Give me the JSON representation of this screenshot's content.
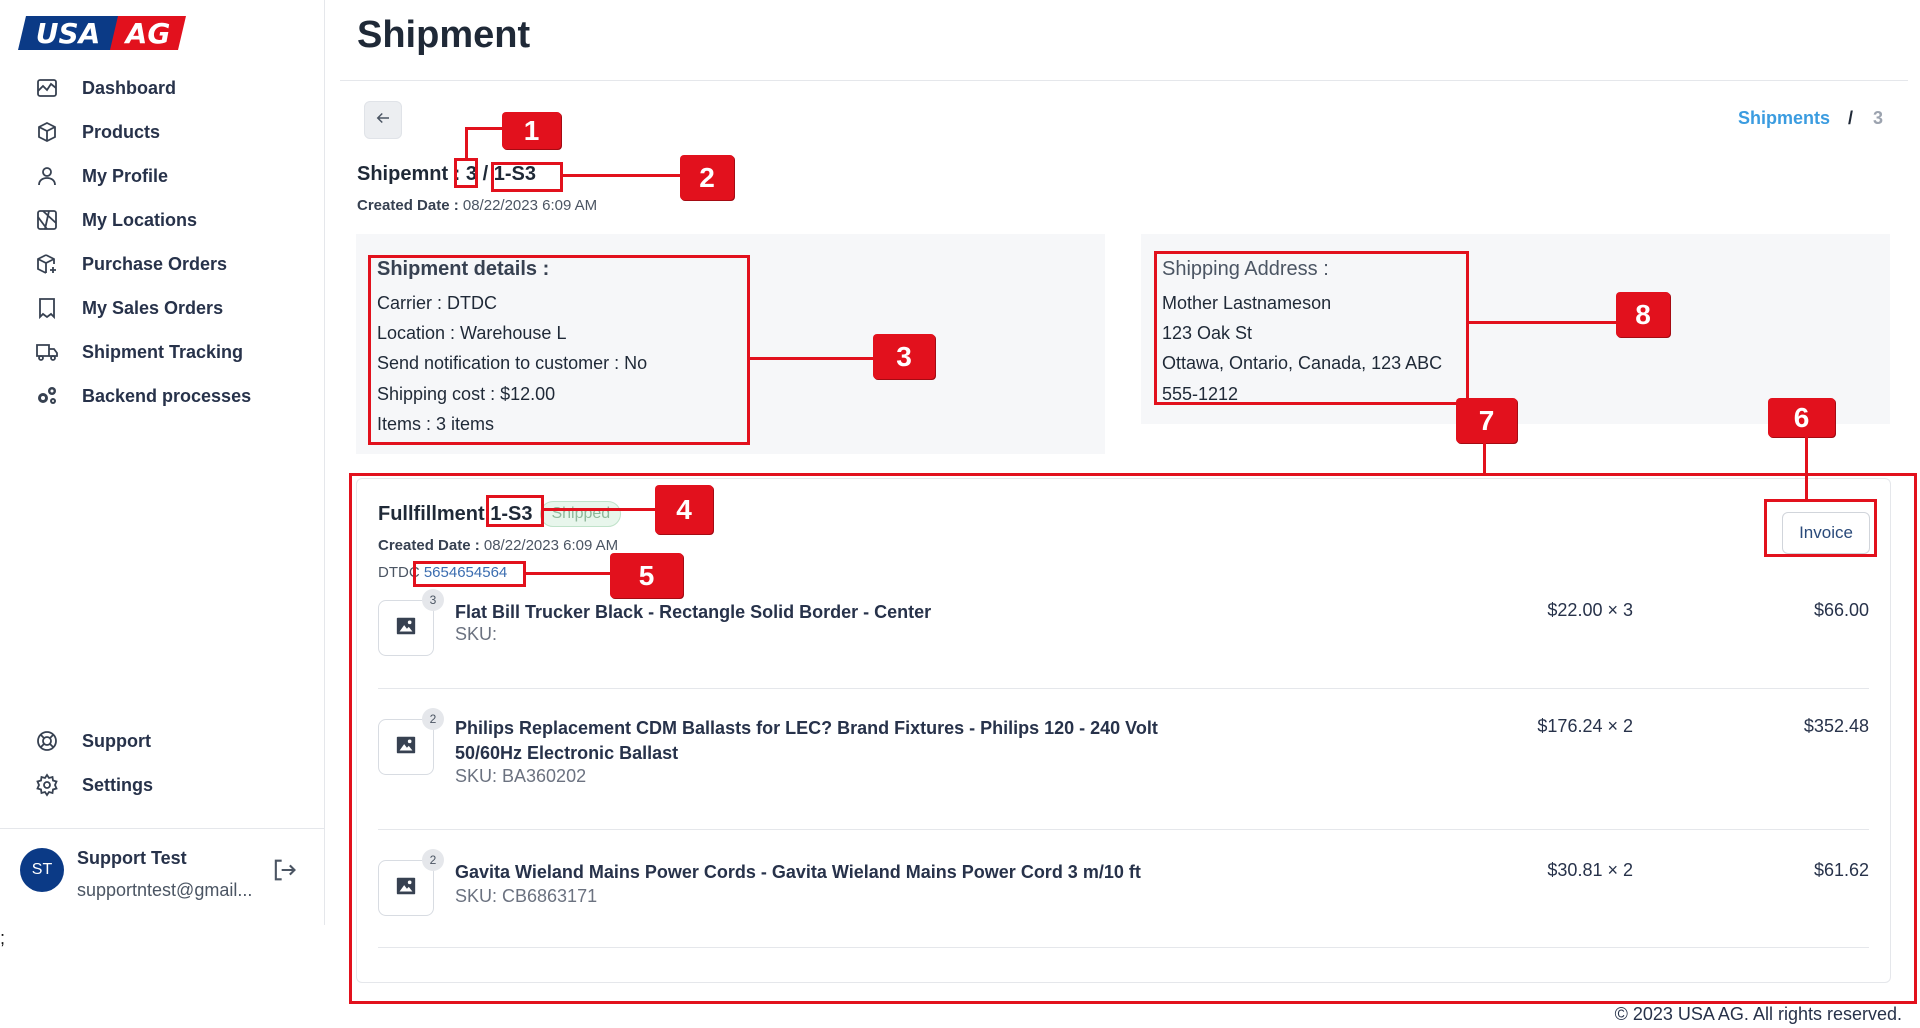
{
  "brand": {
    "logo_text_left": "USA",
    "logo_text_right": "AG",
    "primary_color": "#0b3a86",
    "accent_color": "#e2111d"
  },
  "sidebar": {
    "items": [
      {
        "label": "Dashboard",
        "icon": "chart-icon"
      },
      {
        "label": "Products",
        "icon": "box-icon"
      },
      {
        "label": "My Profile",
        "icon": "user-icon"
      },
      {
        "label": "My Locations",
        "icon": "map-icon"
      },
      {
        "label": "Purchase Orders",
        "icon": "package-plus-icon"
      },
      {
        "label": "My Sales Orders",
        "icon": "receipt-icon"
      },
      {
        "label": "Shipment Tracking",
        "icon": "truck-icon"
      },
      {
        "label": "Backend processes",
        "icon": "gears-icon"
      }
    ],
    "bottom_items": [
      {
        "label": "Support",
        "icon": "lifebuoy-icon"
      },
      {
        "label": "Settings",
        "icon": "gear-icon"
      }
    ],
    "user": {
      "initials": "ST",
      "name": "Support Test",
      "email": "supportntest@gmail..."
    }
  },
  "stray_text": ";",
  "page": {
    "title": "Shipment",
    "breadcrumb": {
      "link": "Shipments",
      "separator": "/",
      "current": "3"
    }
  },
  "shipment": {
    "label": "Shipemnt :",
    "id": "3",
    "separator": "/",
    "code": "1-S3",
    "created_label": "Created Date :",
    "created_value": "08/22/2023 6:09 AM"
  },
  "details": {
    "title": "Shipment details :",
    "lines": [
      "Carrier : DTDC",
      "Location : Warehouse L",
      "Send notification to customer : No",
      "Shipping cost : $12.00",
      "Items : 3 items"
    ]
  },
  "address": {
    "title": "Shipping Address :",
    "lines": [
      "Mother Lastnameson",
      "123 Oak St",
      "Ottawa, Ontario, Canada, 123 ABC",
      "555-1212"
    ]
  },
  "fulfillment": {
    "label": "Fullfillment",
    "code": "1-S3",
    "status": "Shipped",
    "created_label": "Created Date :",
    "created_value": "08/22/2023 6:09 AM",
    "carrier": "DTDC",
    "tracking": "5654654564",
    "invoice_label": "Invoice",
    "items": [
      {
        "qty": "3",
        "name": "Flat Bill Trucker Black - Rectangle Solid Border - Center",
        "sku": "SKU:",
        "price": "$22.00 × 3",
        "total": "$66.00"
      },
      {
        "qty": "2",
        "name": "Philips Replacement CDM Ballasts for LEC? Brand Fixtures - Philips 120 - 240 Volt 50/60Hz Electronic Ballast",
        "sku": "SKU: BA360202",
        "price": "$176.24 × 2",
        "total": "$352.48"
      },
      {
        "qty": "2",
        "name": "Gavita Wieland Mains Power Cords - Gavita Wieland Mains Power Cord 3 m/10 ft",
        "sku": "SKU: CB6863171",
        "price": "$30.81 × 2",
        "total": "$61.62"
      }
    ]
  },
  "annotations": [
    "1",
    "2",
    "3",
    "4",
    "5",
    "6",
    "7",
    "8"
  ],
  "footer": {
    "copyright": "© 2023 USA AG. All rights reserved."
  }
}
